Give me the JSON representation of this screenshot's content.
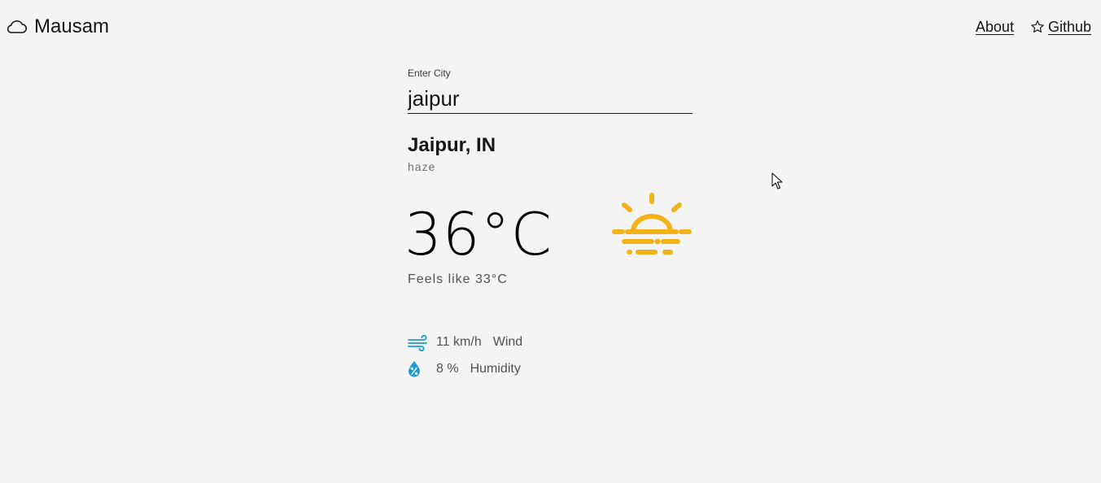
{
  "app": {
    "name": "Mausam",
    "logo_icon": "cloud-icon"
  },
  "nav": {
    "about_label": "About",
    "github_label": "Github",
    "github_icon": "star-icon"
  },
  "search": {
    "label": "Enter City",
    "value": "jaipur"
  },
  "weather": {
    "location": "Jaipur, IN",
    "condition": "haze",
    "temperature": "36°C",
    "feels_like": "Feels like 33°C",
    "icon": "haze-sun-icon",
    "icon_color": "#f1b317",
    "wind": {
      "value": "11 km/h",
      "label": "Wind",
      "icon": "wind-icon"
    },
    "humidity": {
      "value": "8 %",
      "label": "Humidity",
      "icon": "humidity-drop-icon"
    },
    "stat_icon_color": "#1b9ad6"
  }
}
